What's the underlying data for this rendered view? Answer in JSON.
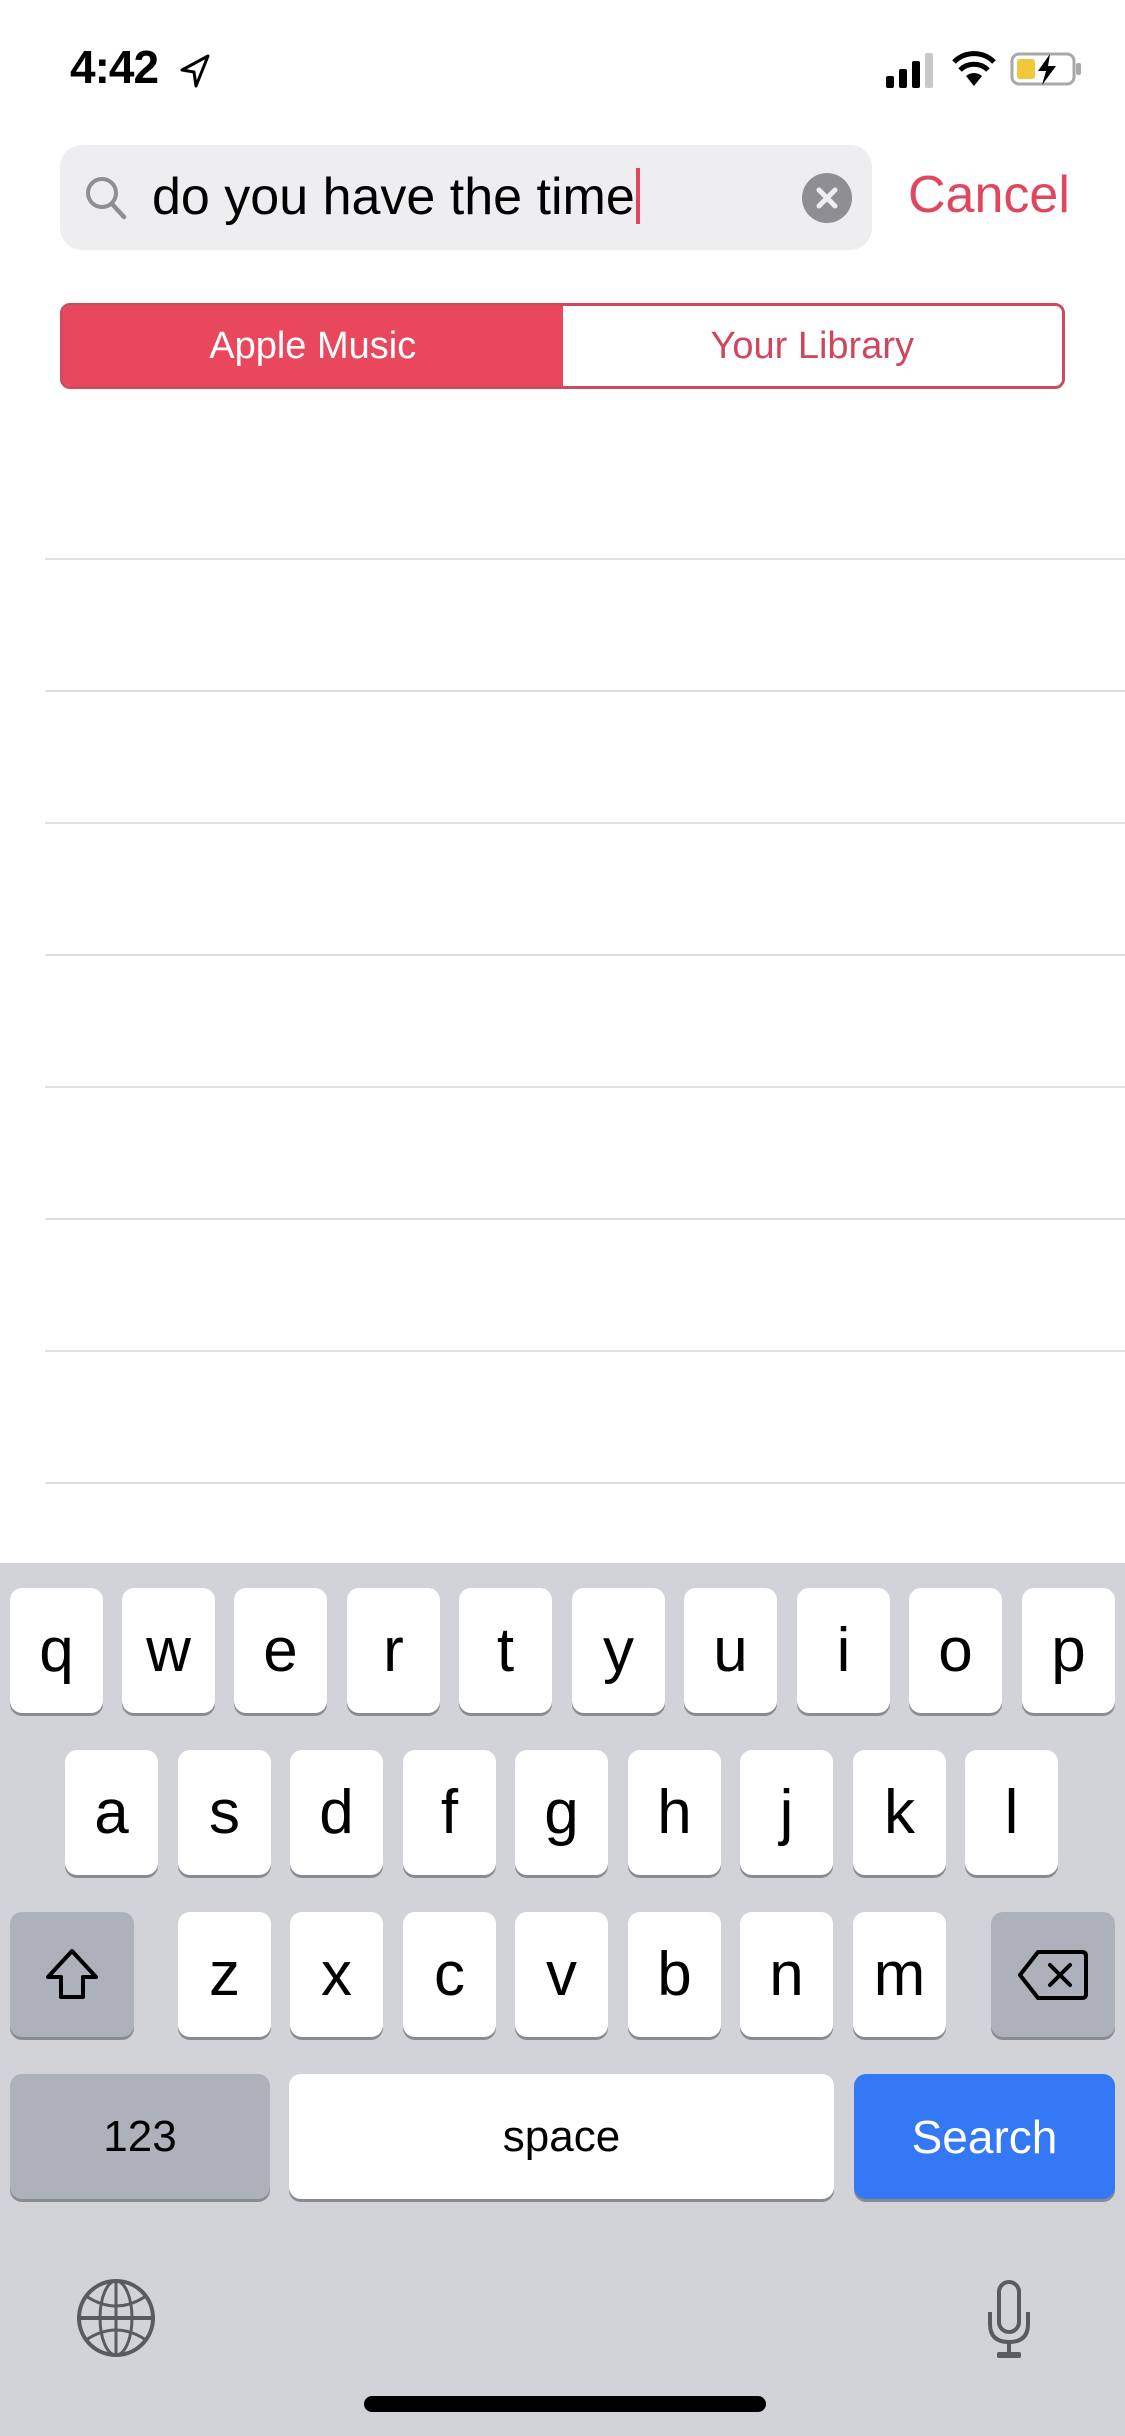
{
  "status_bar": {
    "time": "4:42",
    "icons": [
      "location-arrow-icon",
      "cellular-signal-icon",
      "wifi-icon",
      "battery-charging-icon"
    ]
  },
  "search": {
    "query": "do you have the time",
    "cancel_label": "Cancel",
    "icon": "search-icon",
    "clear_icon": "clear-icon"
  },
  "segmented_control": {
    "options": [
      {
        "label": "Apple Music",
        "selected": true
      },
      {
        "label": "Your Library",
        "selected": false
      }
    ]
  },
  "results": {
    "row_count": 8
  },
  "keyboard": {
    "row1": [
      "q",
      "w",
      "e",
      "r",
      "t",
      "y",
      "u",
      "i",
      "o",
      "p"
    ],
    "row2": [
      "a",
      "s",
      "d",
      "f",
      "g",
      "h",
      "j",
      "k",
      "l"
    ],
    "row3": [
      "z",
      "x",
      "c",
      "v",
      "b",
      "n",
      "m"
    ],
    "numbers_label": "123",
    "space_label": "space",
    "return_label": "Search",
    "icons": [
      "shift-icon",
      "backspace-icon",
      "globe-icon",
      "microphone-icon"
    ]
  },
  "colors": {
    "accent": "#e9475d",
    "keyboard_bg": "#d1d3d8",
    "search_key": "#3478f6"
  }
}
